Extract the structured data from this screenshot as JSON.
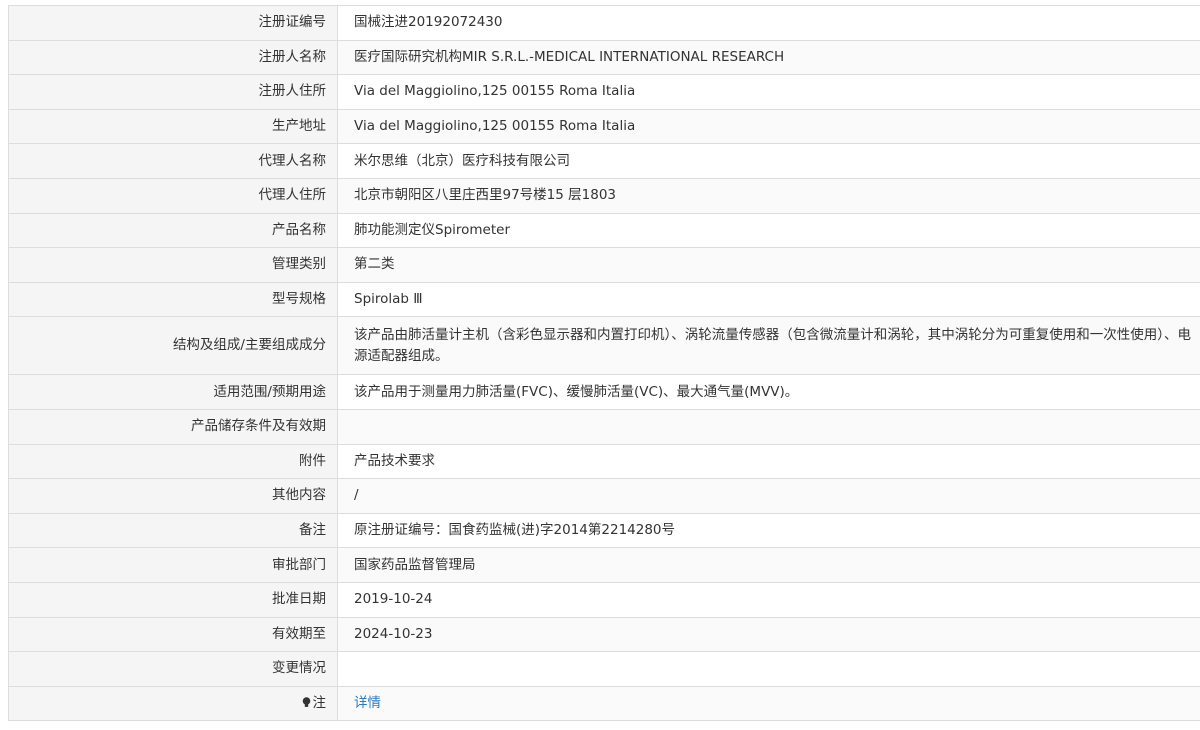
{
  "rows": [
    {
      "label": "注册证编号",
      "value": "国械注进20192072430"
    },
    {
      "label": "注册人名称",
      "value": "医疗国际研究机构MIR S.R.L.-MEDICAL INTERNATIONAL RESEARCH"
    },
    {
      "label": "注册人住所",
      "value": "Via del Maggiolino,125 00155 Roma Italia"
    },
    {
      "label": "生产地址",
      "value": "Via del Maggiolino,125 00155 Roma Italia"
    },
    {
      "label": "代理人名称",
      "value": "米尔思维（北京）医疗科技有限公司"
    },
    {
      "label": "代理人住所",
      "value": "北京市朝阳区八里庄西里97号楼15 层1803"
    },
    {
      "label": "产品名称",
      "value": "肺功能测定仪Spirometer"
    },
    {
      "label": "管理类别",
      "value": "第二类"
    },
    {
      "label": "型号规格",
      "value": "Spirolab Ⅲ"
    },
    {
      "label": "结构及组成/主要组成成分",
      "value": "该产品由肺活量计主机（含彩色显示器和内置打印机）、涡轮流量传感器（包含微流量计和涡轮，其中涡轮分为可重复使用和一次性使用）、电源适配器组成。"
    },
    {
      "label": "适用范围/预期用途",
      "value": "该产品用于测量用力肺活量(FVC)、缓慢肺活量(VC)、最大通气量(MVV)。"
    },
    {
      "label": "产品储存条件及有效期",
      "value": ""
    },
    {
      "label": "附件",
      "value": "产品技术要求"
    },
    {
      "label": "其他内容",
      "value": "/"
    },
    {
      "label": "备注",
      "value": "原注册证编号：国食药监械(进)字2014第2214280号"
    },
    {
      "label": "审批部门",
      "value": "国家药品监督管理局"
    },
    {
      "label": "批准日期",
      "value": "2019-10-24"
    },
    {
      "label": "有效期至",
      "value": "2024-10-23"
    },
    {
      "label": "变更情况",
      "value": ""
    }
  ],
  "note_row": {
    "icon": "lightbulb-icon",
    "label": "注",
    "link_text": "详情"
  },
  "colors": {
    "label_bg": "#f5f5f5",
    "border": "#dddddd",
    "link": "#2a7ac2"
  }
}
